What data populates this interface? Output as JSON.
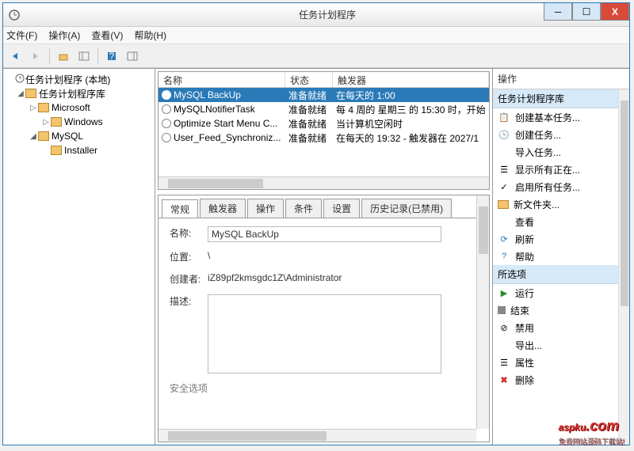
{
  "window": {
    "title": "任务计划程序"
  },
  "menu": {
    "file": "文件(F)",
    "action": "操作(A)",
    "view": "查看(V)",
    "help": "帮助(H)"
  },
  "tree": {
    "root": "任务计划程序 (本地)",
    "lib": "任务计划程序库",
    "ms": "Microsoft",
    "win": "Windows",
    "mysql": "MySQL",
    "installer": "Installer"
  },
  "tasklist": {
    "headers": {
      "name": "名称",
      "status": "状态",
      "trigger": "触发器"
    },
    "rows": [
      {
        "name": "MySQL BackUp",
        "status": "准备就绪",
        "trigger": "在每天的 1:00"
      },
      {
        "name": "MySQLNotifierTask",
        "status": "准备就绪",
        "trigger": "每 4 周的 星期三 的 15:30 时，开始"
      },
      {
        "name": "Optimize Start Menu C...",
        "status": "准备就绪",
        "trigger": "当计算机空闲时"
      },
      {
        "name": "User_Feed_Synchroniz...",
        "status": "准备就绪",
        "trigger": "在每天的 19:32 - 触发器在 2027/1"
      }
    ]
  },
  "tabs": {
    "general": "常规",
    "triggers": "触发器",
    "actions": "操作",
    "conditions": "条件",
    "settings": "设置",
    "history": "历史记录(已禁用)"
  },
  "detail": {
    "name_label": "名称:",
    "name": "MySQL BackUp",
    "location_label": "位置:",
    "location": "\\",
    "author_label": "创建者:",
    "author": "iZ89pf2kmsgdc1Z\\Administrator",
    "desc_label": "描述:",
    "security_label": "安全选项"
  },
  "actions": {
    "title": "操作",
    "head1": "任务计划程序库",
    "items1": [
      "创建基本任务...",
      "创建任务...",
      "导入任务...",
      "显示所有正在...",
      "启用所有任务...",
      "新文件夹...",
      "查看",
      "刷新",
      "帮助"
    ],
    "head2": "所选项",
    "items2": [
      "运行",
      "结束",
      "禁用",
      "导出...",
      "属性",
      "删除"
    ]
  },
  "watermark": {
    "text": "aspku",
    "dotcom": ".com",
    "sub": "免费网站源码下载站!"
  }
}
